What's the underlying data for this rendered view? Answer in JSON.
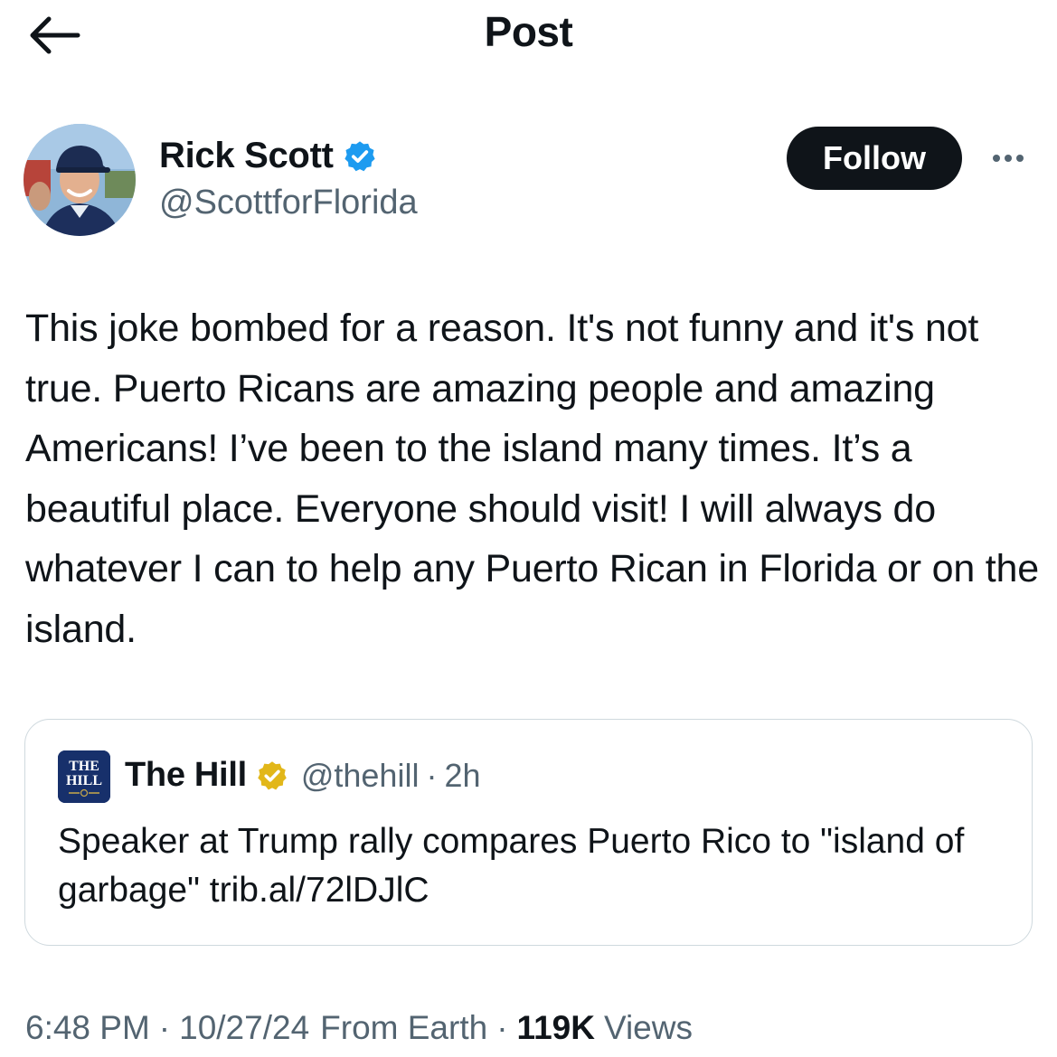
{
  "header": {
    "title": "Post",
    "back_icon": "arrow-left-icon"
  },
  "author": {
    "name": "Rick Scott",
    "handle": "@ScottforFlorida",
    "verified": true,
    "verified_color": "#1d9bf0",
    "follow_label": "Follow",
    "more_icon": "more-horizontal-icon"
  },
  "post": {
    "text": "This joke bombed for a reason. It's not funny and it's not true. Puerto Ricans are amazing people and amazing Americans! I’ve been to the island many times. It’s a beautiful place. Everyone should visit! I will always do whatever I can to help any Puerto Rican in Florida or on the island."
  },
  "quote": {
    "logo_line1": "THE",
    "logo_line2": "HILL",
    "name": "The Hill",
    "verified_color": "#e2b719",
    "handle": "@thehill",
    "separator": "·",
    "time": "2h",
    "text": "Speaker at Trump rally compares Puerto Rico to \"island of garbage\" trib.al/72lDJlC"
  },
  "meta": {
    "time": "6:48 PM",
    "date": "10/27/24",
    "location": "From Earth",
    "separator": "·",
    "views_count": "119K",
    "views_label": "Views"
  },
  "colors": {
    "text_primary": "#0f1419",
    "text_secondary": "#536471",
    "border": "#cfd9de",
    "follow_bg": "#0f1419"
  }
}
